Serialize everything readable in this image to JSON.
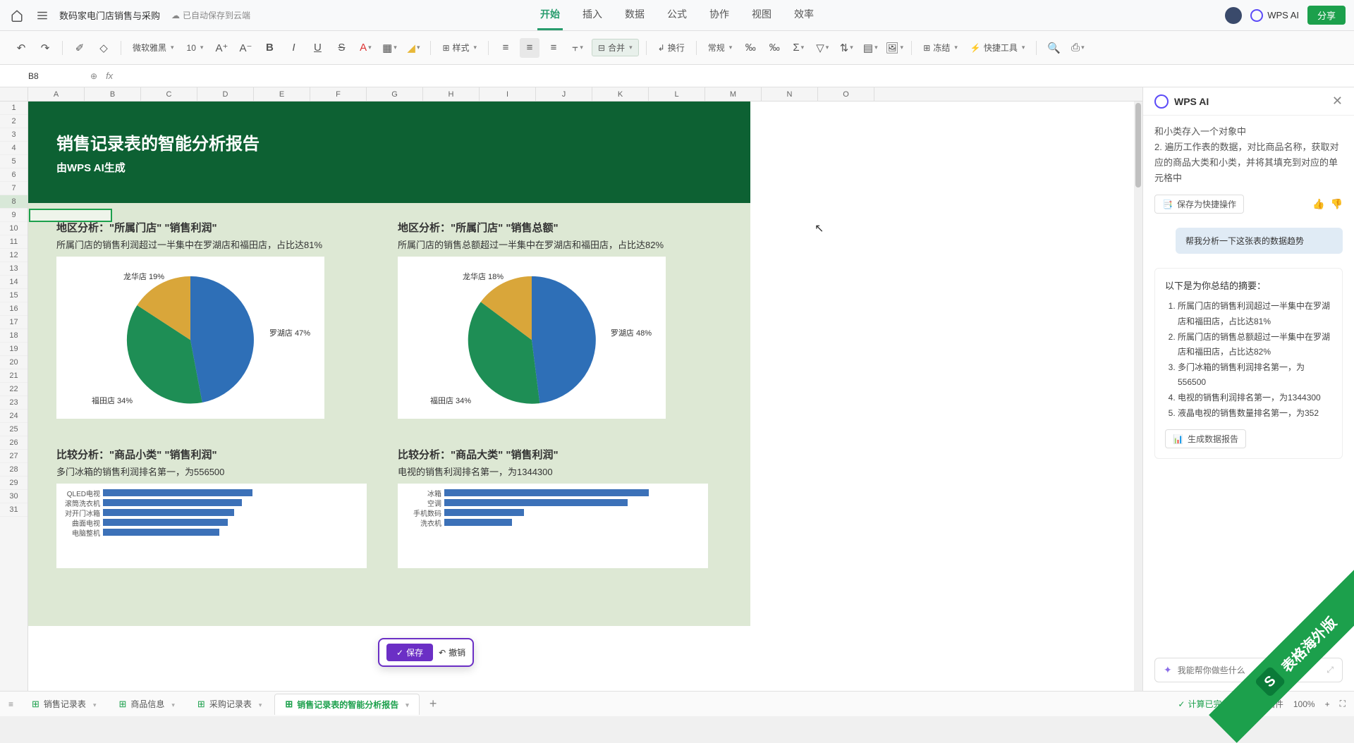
{
  "titlebar": {
    "doc_title": "数码家电门店销售与采购",
    "save_status": "已自动保存到云端",
    "share": "分享",
    "wps_ai": "WPS AI"
  },
  "menubar": [
    "开始",
    "插入",
    "数据",
    "公式",
    "协作",
    "视图",
    "效率"
  ],
  "menubar_active": 0,
  "toolbar": {
    "font": "微软雅黑",
    "size": "10",
    "style": "样式",
    "merge": "合并",
    "wrap": "换行",
    "format": "常规",
    "freeze": "冻结",
    "quick": "快捷工具"
  },
  "formula_bar": {
    "cell": "B8"
  },
  "columns": [
    "A",
    "B",
    "C",
    "D",
    "E",
    "F",
    "G",
    "H",
    "I",
    "J",
    "K",
    "L",
    "M",
    "N",
    "O"
  ],
  "rows": [
    1,
    2,
    3,
    4,
    5,
    6,
    7,
    8,
    9,
    10,
    11,
    12,
    13,
    14,
    15,
    16,
    17,
    18,
    19,
    20,
    21,
    22,
    23,
    24,
    25,
    26,
    27,
    28,
    29,
    30,
    31
  ],
  "selected_row": 8,
  "report": {
    "title": "销售记录表的智能分析报告",
    "subtitle": "由WPS AI生成",
    "section1": {
      "left": {
        "title": "地区分析：\"所属门店\" \"销售利润\"",
        "subtitle": "所属门店的销售利润超过一半集中在罗湖店和福田店，占比达81%"
      },
      "right": {
        "title": "地区分析：\"所属门店\" \"销售总额\"",
        "subtitle": "所属门店的销售总额超过一半集中在罗湖店和福田店，占比达82%"
      }
    },
    "section2": {
      "left": {
        "title": "比较分析：\"商品小类\" \"销售利润\"",
        "subtitle": "多门冰箱的销售利润排名第一，为556500"
      },
      "right": {
        "title": "比较分析：\"商品大类\" \"销售利润\"",
        "subtitle": "电视的销售利润排名第一，为1344300"
      }
    }
  },
  "chart_data": [
    {
      "type": "pie",
      "title": "地区分析：所属门店 销售利润",
      "series": [
        {
          "name": "罗湖店",
          "value": 47,
          "color": "#2e6fb7"
        },
        {
          "name": "福田店",
          "value": 34,
          "color": "#1e8e55"
        },
        {
          "name": "龙华店",
          "value": 19,
          "color": "#d9a63a"
        }
      ],
      "labels": {
        "l1": "罗湖店 47%",
        "l2": "福田店 34%",
        "l3": "龙华店 19%"
      }
    },
    {
      "type": "pie",
      "title": "地区分析：所属门店 销售总额",
      "series": [
        {
          "name": "罗湖店",
          "value": 48,
          "color": "#2e6fb7"
        },
        {
          "name": "福田店",
          "value": 34,
          "color": "#1e8e55"
        },
        {
          "name": "龙华店",
          "value": 18,
          "color": "#d9a63a"
        }
      ],
      "labels": {
        "l1": "罗湖店 48%",
        "l2": "福田店 34%",
        "l3": "龙华店 18%"
      }
    },
    {
      "type": "bar",
      "orientation": "horizontal",
      "title": "比较分析：商品小类 销售利润",
      "categories": [
        "QLED电视",
        "滚筒洗衣机",
        "对开门冰箱",
        "曲面电视",
        "电脑整机"
      ],
      "values": [
        360000,
        335000,
        315000,
        300000,
        280000
      ],
      "xlim": [
        0,
        560000
      ]
    },
    {
      "type": "bar",
      "orientation": "horizontal",
      "title": "比较分析：商品大类 销售利润",
      "categories": [
        "冰箱",
        "空调",
        "手机数码",
        "洗衣机"
      ],
      "values": [
        1180000,
        1060000,
        460000,
        390000
      ],
      "xlim": [
        0,
        1344300
      ]
    }
  ],
  "float_action": {
    "save": "保存",
    "undo": "撤销"
  },
  "ai_panel": {
    "title": "WPS AI",
    "context": "和小类存入一个对象中\n2. 遍历工作表的数据，对比商品名称，获取对应的商品大类和小类，并将其填充到对应的单元格中",
    "quick_save": "保存为快捷操作",
    "user_msg": "帮我分析一下这张表的数据趋势",
    "summary_intro": "以下是为你总结的摘要：",
    "summary": [
      "所属门店的销售利润超过一半集中在罗湖店和福田店，占比达81%",
      "所属门店的销售总额超过一半集中在罗湖店和福田店，占比达82%",
      "多门冰箱的销售利润排名第一，为556500",
      "电视的销售利润排名第一，为1344300",
      "液晶电视的销售数量排名第一，为352"
    ],
    "gen_report": "生成数据报告",
    "input_placeholder": "我能帮你做些什么"
  },
  "sheets": {
    "tabs": [
      "销售记录表",
      "商品信息",
      "采购记录表",
      "销售记录表的智能分析报告"
    ],
    "active": 3,
    "status_calc": "计算已完成",
    "status_expand": "扩展插件",
    "zoom": "100%"
  },
  "ribbon": "表格海外版"
}
